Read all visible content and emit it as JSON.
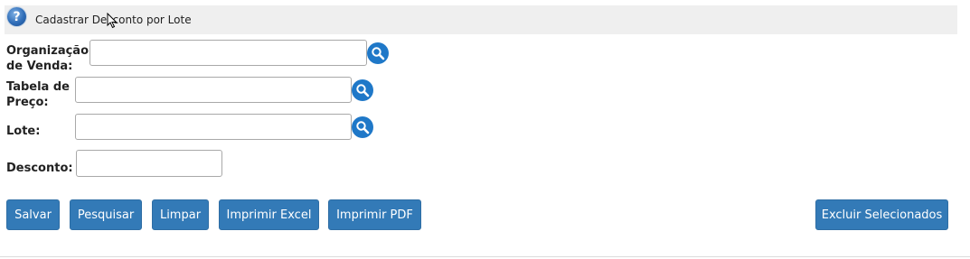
{
  "header": {
    "title": "Cadastrar Desconto por Lote",
    "help_icon": "question-circle-icon"
  },
  "form": {
    "organizacao": {
      "label_line1": "Organização",
      "label_line2": "de Venda:",
      "value": ""
    },
    "tabela": {
      "label_line1": "Tabela de",
      "label_line2": "Preço:",
      "value": ""
    },
    "lote": {
      "label": "Lote:",
      "value": ""
    },
    "desconto": {
      "label": "Desconto:",
      "value": ""
    },
    "search_icon": "magnifier-icon"
  },
  "buttons": {
    "salvar": "Salvar",
    "pesquisar": "Pesquisar",
    "limpar": "Limpar",
    "imprimir_excel": "Imprimir Excel",
    "imprimir_pdf": "Imprimir PDF",
    "excluir_selecionados": "Excluir Selecionados"
  },
  "colors": {
    "button_primary": "#337ab7",
    "search_icon_bg": "#1f78c8",
    "title_bar_bg": "#efefef"
  }
}
